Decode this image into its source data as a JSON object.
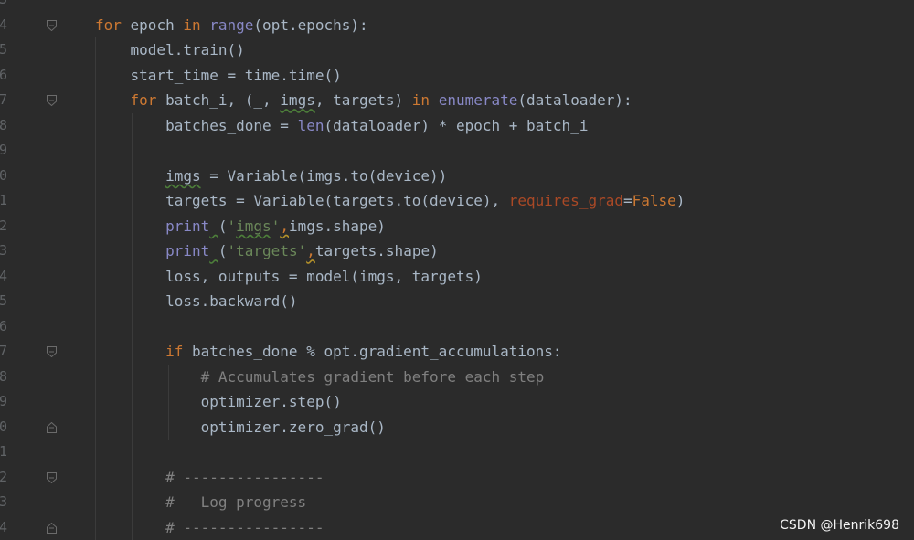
{
  "editor": {
    "line_numbers": [
      "3",
      "4",
      "5",
      "6",
      "7",
      "8",
      "9",
      "0",
      "1",
      "2",
      "3",
      "4",
      "5",
      "6",
      "7",
      "8",
      "9",
      "0",
      "1",
      "2",
      "3",
      "4"
    ],
    "lines": [
      [],
      [
        {
          "t": "for",
          "c": "kw"
        },
        {
          "t": " epoch ",
          "c": ""
        },
        {
          "t": "in",
          "c": "kw"
        },
        {
          "t": " ",
          "c": ""
        },
        {
          "t": "range",
          "c": "bi"
        },
        {
          "t": "(opt.epochs):",
          "c": ""
        }
      ],
      [
        {
          "t": "    model.train()",
          "c": ""
        }
      ],
      [
        {
          "t": "    start_time = time.time()",
          "c": ""
        }
      ],
      [
        {
          "t": "    ",
          "c": ""
        },
        {
          "t": "for",
          "c": "kw"
        },
        {
          "t": " batch_i, (_, ",
          "c": ""
        },
        {
          "t": "imgs",
          "c": "squig"
        },
        {
          "t": ", targets) ",
          "c": ""
        },
        {
          "t": "in",
          "c": "kw"
        },
        {
          "t": " ",
          "c": ""
        },
        {
          "t": "enumerate",
          "c": "bi"
        },
        {
          "t": "(dataloader):",
          "c": ""
        }
      ],
      [
        {
          "t": "        batches_done = ",
          "c": ""
        },
        {
          "t": "len",
          "c": "bi"
        },
        {
          "t": "(dataloader) * epoch + batch_i",
          "c": ""
        }
      ],
      [],
      [
        {
          "t": "        ",
          "c": ""
        },
        {
          "t": "imgs",
          "c": "squig"
        },
        {
          "t": " = Variable(imgs.to(device))",
          "c": ""
        }
      ],
      [
        {
          "t": "        targets = Variable(targets.to(device), ",
          "c": ""
        },
        {
          "t": "requires_grad",
          "c": "param"
        },
        {
          "t": "=",
          "c": ""
        },
        {
          "t": "False",
          "c": "kw"
        },
        {
          "t": ")",
          "c": ""
        }
      ],
      [
        {
          "t": "        ",
          "c": ""
        },
        {
          "t": "print",
          "c": "bi"
        },
        {
          "t": " ",
          "c": "squig"
        },
        {
          "t": "(",
          "c": ""
        },
        {
          "t": "'",
          "c": "str"
        },
        {
          "t": "imgs",
          "c": "str squig"
        },
        {
          "t": "'",
          "c": "str"
        },
        {
          "t": ",",
          "c": "kw squig-y"
        },
        {
          "t": "imgs.shape)",
          "c": ""
        }
      ],
      [
        {
          "t": "        ",
          "c": ""
        },
        {
          "t": "print",
          "c": "bi"
        },
        {
          "t": " ",
          "c": "squig"
        },
        {
          "t": "(",
          "c": ""
        },
        {
          "t": "'targets'",
          "c": "str"
        },
        {
          "t": ",",
          "c": "kw squig-y"
        },
        {
          "t": "targets.shape)",
          "c": ""
        }
      ],
      [
        {
          "t": "        loss, outputs = model(imgs, targets)",
          "c": ""
        }
      ],
      [
        {
          "t": "        loss.backward()",
          "c": ""
        }
      ],
      [],
      [
        {
          "t": "        ",
          "c": ""
        },
        {
          "t": "if",
          "c": "kw"
        },
        {
          "t": " batches_done % opt.gradient_accumulations:",
          "c": ""
        }
      ],
      [
        {
          "t": "            ",
          "c": ""
        },
        {
          "t": "# Accumulates gradient before each step",
          "c": "cmt"
        }
      ],
      [
        {
          "t": "            optimizer.step()",
          "c": ""
        }
      ],
      [
        {
          "t": "            optimizer.zero_grad()",
          "c": ""
        }
      ],
      [],
      [
        {
          "t": "        ",
          "c": ""
        },
        {
          "t": "# ----------------",
          "c": "cmt"
        }
      ],
      [
        {
          "t": "        ",
          "c": ""
        },
        {
          "t": "#   Log progress",
          "c": "cmt"
        }
      ],
      [
        {
          "t": "        ",
          "c": ""
        },
        {
          "t": "# ----------------",
          "c": "cmt"
        }
      ]
    ],
    "fold_markers": [
      {
        "line": 1,
        "kind": "open"
      },
      {
        "line": 4,
        "kind": "open"
      },
      {
        "line": 14,
        "kind": "open"
      },
      {
        "line": 17,
        "kind": "close"
      },
      {
        "line": 19,
        "kind": "open"
      },
      {
        "line": 21,
        "kind": "close"
      }
    ]
  },
  "watermark": "CSDN @Henrik698"
}
